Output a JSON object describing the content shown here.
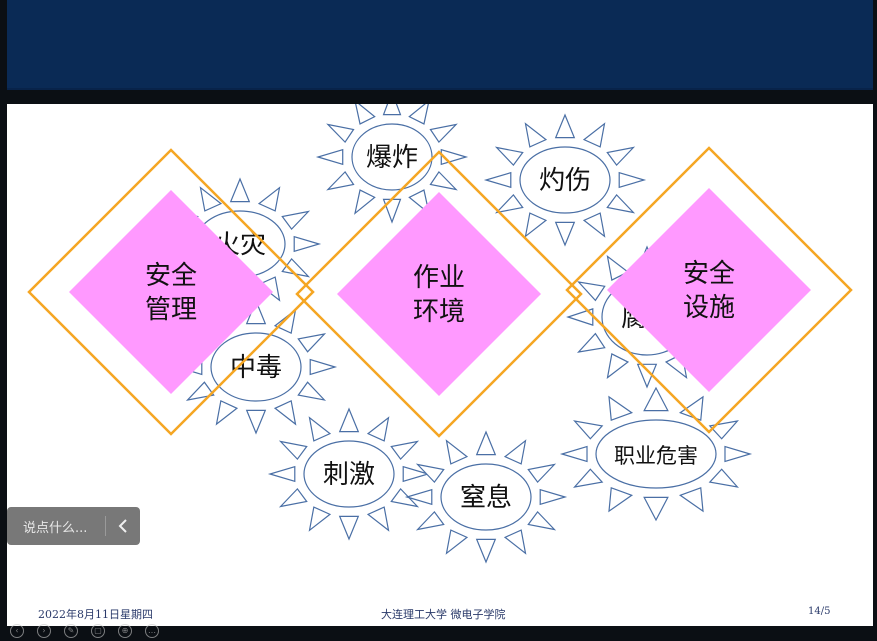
{
  "slide": {
    "bursts": [
      {
        "label": "爆炸"
      },
      {
        "label": "灼伤"
      },
      {
        "label": "火灾"
      },
      {
        "label": "中毒"
      },
      {
        "label": "腐蚀"
      },
      {
        "label": "刺激"
      },
      {
        "label": "窒息"
      },
      {
        "label": "职业危害"
      }
    ],
    "diamonds": [
      {
        "line1": "安全",
        "line2": "管理"
      },
      {
        "line1": "作业",
        "line2": "环境"
      },
      {
        "line1": "安全",
        "line2": "设施"
      }
    ]
  },
  "footer": {
    "date": "2022年8月11日星期四",
    "center": "大连理工大学  微电子学院",
    "page": "14/5"
  },
  "comment": {
    "placeholder": "说点什么..."
  },
  "colors": {
    "header": "#0a2a55",
    "diamond_fill": "#ff99ff",
    "diamond_outline": "#f5a623",
    "burst_stroke": "#4a6fa5"
  }
}
